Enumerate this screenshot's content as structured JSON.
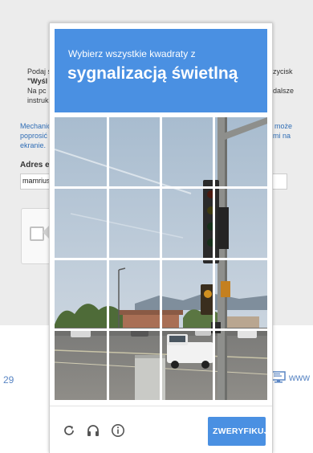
{
  "background": {
    "lines": [
      {
        "text": "Podaj s",
        "x": "left"
      },
      {
        "text": "\"Wyśl",
        "bold": true
      },
      {
        "text": "Na  pc"
      },
      {
        "text": "instruk"
      }
    ],
    "right_lines": [
      "zycisk",
      "dalsze"
    ],
    "mechanic_lines": [
      "Mechanic",
      "poprosić",
      "ekranie."
    ],
    "mechanic_right": [
      "może",
      "mi na"
    ],
    "email_label": "Adres e",
    "email_value": "mamrius",
    "footer_number": "29",
    "footer_link": "www"
  },
  "captcha": {
    "instruction": "Wybierz wszystkie kwadraty z",
    "target": "sygnalizacją świetlną",
    "verify_label": "ZWERYFIKUJ",
    "icons": [
      "reload-icon",
      "audio-icon",
      "info-icon"
    ],
    "grid": {
      "rows": 4,
      "cols": 4
    },
    "accent_color": "#4a90e2"
  }
}
